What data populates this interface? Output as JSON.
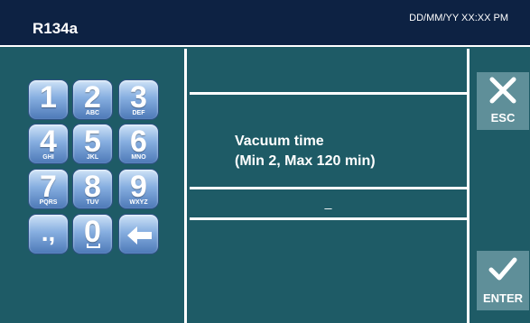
{
  "header": {
    "title": "R134a",
    "datetime": "DD/MM/YY XX:XX PM"
  },
  "keypad": {
    "keys": [
      {
        "digit": "1",
        "letters": ""
      },
      {
        "digit": "2",
        "letters": "ABC"
      },
      {
        "digit": "3",
        "letters": "DEF"
      },
      {
        "digit": "4",
        "letters": "GHI"
      },
      {
        "digit": "5",
        "letters": "JKL"
      },
      {
        "digit": "6",
        "letters": "MNO"
      },
      {
        "digit": "7",
        "letters": "PQRS"
      },
      {
        "digit": "8",
        "letters": "TUV"
      },
      {
        "digit": "9",
        "letters": "WXYZ"
      }
    ],
    "punct_label": ".,",
    "zero_digit": "0",
    "backspace_icon": "arrow-left-icon"
  },
  "prompt": {
    "line1": "Vacuum time",
    "line2": "(Min 2, Max 120 min)"
  },
  "input": {
    "value": "_"
  },
  "actions": {
    "esc_label": "ESC",
    "esc_icon": "close-icon",
    "enter_label": "ENTER",
    "enter_icon": "checkmark-icon"
  },
  "colors": {
    "header_bg": "#0d2243",
    "panel_bg": "#1e5b66",
    "button_bg": "#5f8f99",
    "key_blue": "#4d79b7"
  }
}
